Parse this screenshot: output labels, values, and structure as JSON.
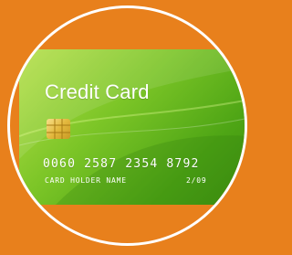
{
  "colors": {
    "background": "#e8801c",
    "ring": "#ffffff",
    "card_light": "#b6e04a",
    "card_dark": "#3d8f10",
    "chip": "#e3b83e"
  },
  "card": {
    "title": "Credit Card",
    "number": "0060 2587 2354 8792",
    "holder_label": "CARD HOLDER NAME",
    "expiry": "2/09",
    "chip_icon": "chip-icon"
  }
}
